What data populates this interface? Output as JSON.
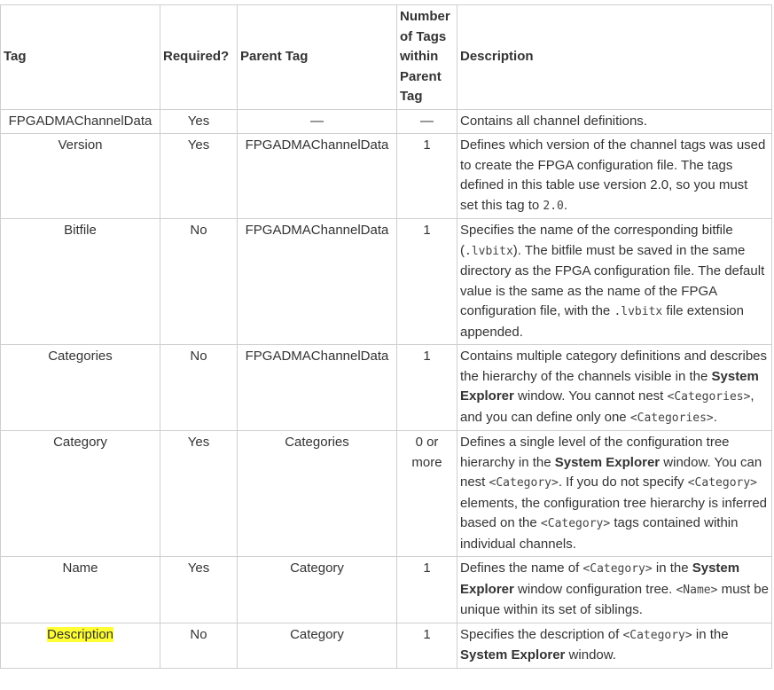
{
  "headers": [
    "Tag",
    "Required?",
    "Parent Tag",
    "Number of Tags within Parent Tag",
    "Description"
  ],
  "rows": [
    {
      "tag": "FPGADMAChannelData",
      "required": "Yes",
      "parent": "—",
      "count": "—",
      "desc": [
        {
          "t": "text",
          "v": "Contains all channel definitions."
        }
      ]
    },
    {
      "tag": "Version",
      "required": "Yes",
      "parent": "FPGADMAChannelData",
      "count": "1",
      "desc": [
        {
          "t": "text",
          "v": "Defines which version of the channel tags was used to create the FPGA configuration file. The tags defined in this table use version 2.0, so you must set this tag to "
        },
        {
          "t": "code",
          "v": "2.0"
        },
        {
          "t": "text",
          "v": "."
        }
      ]
    },
    {
      "tag": "Bitfile",
      "required": "No",
      "parent": "FPGADMAChannelData",
      "count": "1",
      "desc": [
        {
          "t": "text",
          "v": "Specifies the name of the corresponding bitfile ("
        },
        {
          "t": "code",
          "v": ".lvbitx"
        },
        {
          "t": "text",
          "v": "). The bitfile must be saved in the same directory as the FPGA configuration file. The default value is the same as the name of the FPGA configuration file, with the "
        },
        {
          "t": "code",
          "v": ".lvbitx"
        },
        {
          "t": "text",
          "v": " file extension appended."
        }
      ]
    },
    {
      "tag": "Categories",
      "required": "No",
      "parent": "FPGADMAChannelData",
      "count": "1",
      "desc": [
        {
          "t": "text",
          "v": "Contains multiple category definitions and describes the hierarchy of the channels visible in the "
        },
        {
          "t": "bold",
          "v": "System Explorer"
        },
        {
          "t": "text",
          "v": " window. You cannot nest "
        },
        {
          "t": "code",
          "v": "<Categories>"
        },
        {
          "t": "text",
          "v": ", and you can define only one "
        },
        {
          "t": "code",
          "v": "<Categories>"
        },
        {
          "t": "text",
          "v": "."
        }
      ]
    },
    {
      "tag": "Category",
      "required": "Yes",
      "parent": "Categories",
      "count": "0 or more",
      "desc": [
        {
          "t": "text",
          "v": "Defines a single level of the configuration tree hierarchy in the "
        },
        {
          "t": "bold",
          "v": "System Explorer"
        },
        {
          "t": "text",
          "v": " window. You can nest "
        },
        {
          "t": "code",
          "v": "<Category>"
        },
        {
          "t": "text",
          "v": ". If you do not specify "
        },
        {
          "t": "code",
          "v": "<Category>"
        },
        {
          "t": "text",
          "v": " elements, the configuration tree hierarchy is inferred based on the "
        },
        {
          "t": "code",
          "v": "<Category>"
        },
        {
          "t": "text",
          "v": " tags contained within individual channels."
        }
      ]
    },
    {
      "tag": "Name",
      "required": "Yes",
      "parent": "Category",
      "count": "1",
      "desc": [
        {
          "t": "text",
          "v": "Defines the name of "
        },
        {
          "t": "code",
          "v": "<Category>"
        },
        {
          "t": "text",
          "v": " in the "
        },
        {
          "t": "bold",
          "v": "System Explorer"
        },
        {
          "t": "text",
          "v": " window configuration tree. "
        },
        {
          "t": "code",
          "v": "<Name>"
        },
        {
          "t": "text",
          "v": " must be unique within its set of siblings."
        }
      ]
    },
    {
      "tag": "Description",
      "required": "No",
      "parent": "Category",
      "count": "1",
      "highlight": true,
      "desc": [
        {
          "t": "text",
          "v": "Specifies the description of "
        },
        {
          "t": "code",
          "v": "<Category>"
        },
        {
          "t": "text",
          "v": " in the "
        },
        {
          "t": "bold",
          "v": "System Explorer"
        },
        {
          "t": "text",
          "v": " window."
        }
      ]
    }
  ],
  "highlight_color": "#ffff33"
}
